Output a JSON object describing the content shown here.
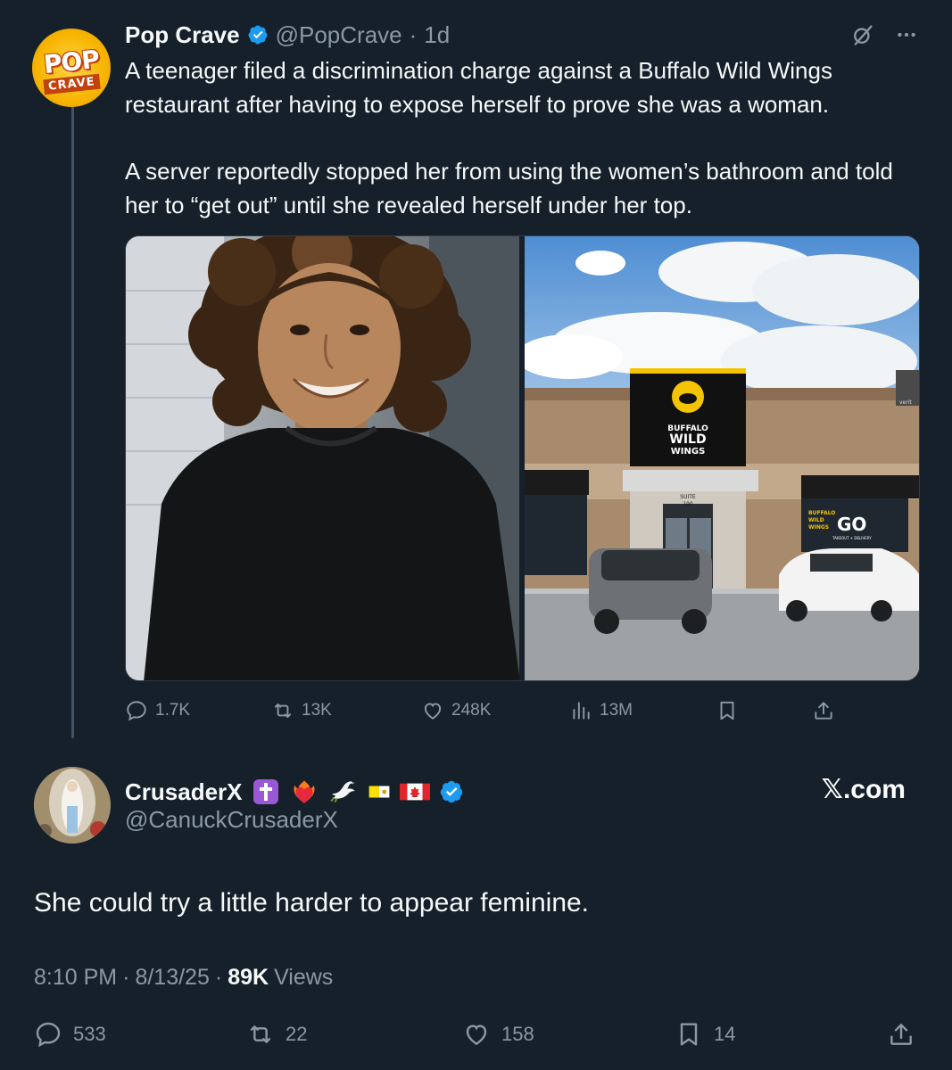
{
  "colors": {
    "background": "#15202b",
    "text": "#f7f9f9",
    "muted": "#8b98a5",
    "verified": "#1d9bf0"
  },
  "parent_tweet": {
    "avatar": {
      "line1": "POP",
      "line2": "CRAVE"
    },
    "name": "Pop Crave",
    "handle": "@PopCrave",
    "separator": "·",
    "time": "1d",
    "paragraphs": [
      "A teenager filed a discrimination charge against a Buffalo Wild Wings restaurant after having to expose herself to prove she was a woman.",
      "A server reportedly stopped her from using the women’s bathroom and told her to “get out” until she revealed herself under her top."
    ],
    "media": {
      "left_image": "portrait of smiling teenager in black t-shirt",
      "right_image": "Buffalo Wild Wings storefront with parked cars",
      "sign_lines": [
        "BUFFALO",
        "WILD",
        "WINGS"
      ],
      "suite_lines": [
        "SUITE",
        "190"
      ],
      "window_sign_lines": [
        "BUFFALO",
        "WILD",
        "WINGS"
      ],
      "window_go": "GO",
      "window_small": "TAKEOUT + DELIVERY",
      "corner_sign": "verit"
    },
    "stats": {
      "replies": "1.7K",
      "reposts": "13K",
      "likes": "248K",
      "views": "13M"
    },
    "icons": [
      "grok-icon",
      "more-icon",
      "reply-icon",
      "repost-icon",
      "like-icon",
      "views-icon",
      "bookmark-icon",
      "share-icon"
    ]
  },
  "reply_tweet": {
    "name": "CrusaderX",
    "emojis": [
      "latin-cross-emoji",
      "heart-on-fire-emoji",
      "dove-emoji",
      "vatican-flag-emoji",
      "canada-flag-emoji"
    ],
    "handle": "@CanuckCrusaderX",
    "watermark": "𝕏.com",
    "text": "She could try a little harder to appear feminine.",
    "time": "8:10 PM",
    "separator": "·",
    "date": "8/13/25",
    "views_count": "89K",
    "views_label": "Views",
    "stats": {
      "replies": "533",
      "reposts": "22",
      "likes": "158",
      "bookmarks": "14"
    }
  }
}
